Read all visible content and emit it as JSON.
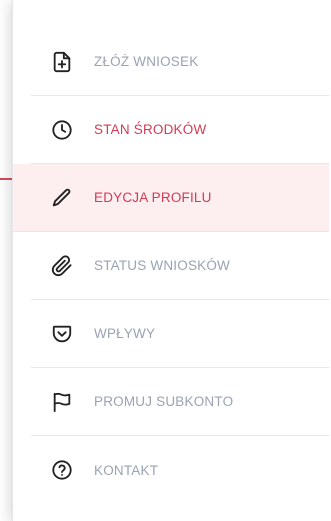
{
  "menu": {
    "items": [
      {
        "label": "ZŁÓŻ WNIOSEK",
        "icon": "document-plus-icon",
        "state": "normal"
      },
      {
        "label": "STAN ŚRODKÓW",
        "icon": "clock-icon",
        "state": "highlight"
      },
      {
        "label": "EDYCJA PROFILU",
        "icon": "pencil-icon",
        "state": "active"
      },
      {
        "label": "STATUS WNIOSKÓW",
        "icon": "paperclip-icon",
        "state": "normal"
      },
      {
        "label": "WPŁYWY",
        "icon": "inbox-chevron-icon",
        "state": "normal"
      },
      {
        "label": "PROMUJ SUBKONTO",
        "icon": "flag-icon",
        "state": "normal"
      },
      {
        "label": "KONTAKT",
        "icon": "question-circle-icon",
        "state": "normal"
      }
    ]
  },
  "colors": {
    "accent": "#d03b55",
    "active_background": "#fdeef0",
    "label_default": "#9aa2b4",
    "icon": "#222222"
  }
}
